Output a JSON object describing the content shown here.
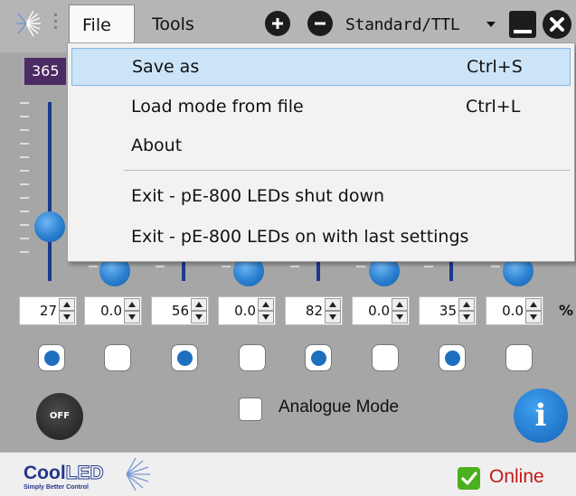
{
  "menubar": {
    "file_label": "File",
    "tools_label": "Tools",
    "mode_value": "Standard/TTL"
  },
  "display_value": "365",
  "channels": [
    {
      "intensity": "27",
      "offset": "0.0",
      "enabled": true
    },
    {
      "intensity": "56",
      "offset": "0.0",
      "enabled": true
    },
    {
      "intensity": "82",
      "offset": "0.0",
      "enabled": true
    },
    {
      "intensity": "35",
      "offset": "0.0",
      "enabled": true
    }
  ],
  "unit_label": "%",
  "controls": {
    "off_label": "OFF",
    "analogue_mode_label": "Analogue Mode",
    "analogue_mode_checked": false,
    "info_label": "i"
  },
  "footer": {
    "brand_cool": "Cool",
    "brand_led": "LED",
    "tagline": "Simply Better Control",
    "status": "Online"
  },
  "file_menu": {
    "items": [
      {
        "label": "Save as",
        "shortcut": "Ctrl+S",
        "highlighted": true
      },
      {
        "label": "Load mode from file",
        "shortcut": "Ctrl+L"
      },
      {
        "label": "About",
        "shortcut": ""
      },
      {
        "label": "Exit - pE-800 LEDs shut down",
        "shortcut": ""
      },
      {
        "label": "Exit - pE-800 LEDs on with last settings",
        "shortcut": ""
      }
    ]
  },
  "colors": {
    "accent_blue": "#1e6fc0",
    "menu_highlight": "#cce4f7",
    "status_online": "#c41818",
    "display_bg": "#4c2a63"
  }
}
